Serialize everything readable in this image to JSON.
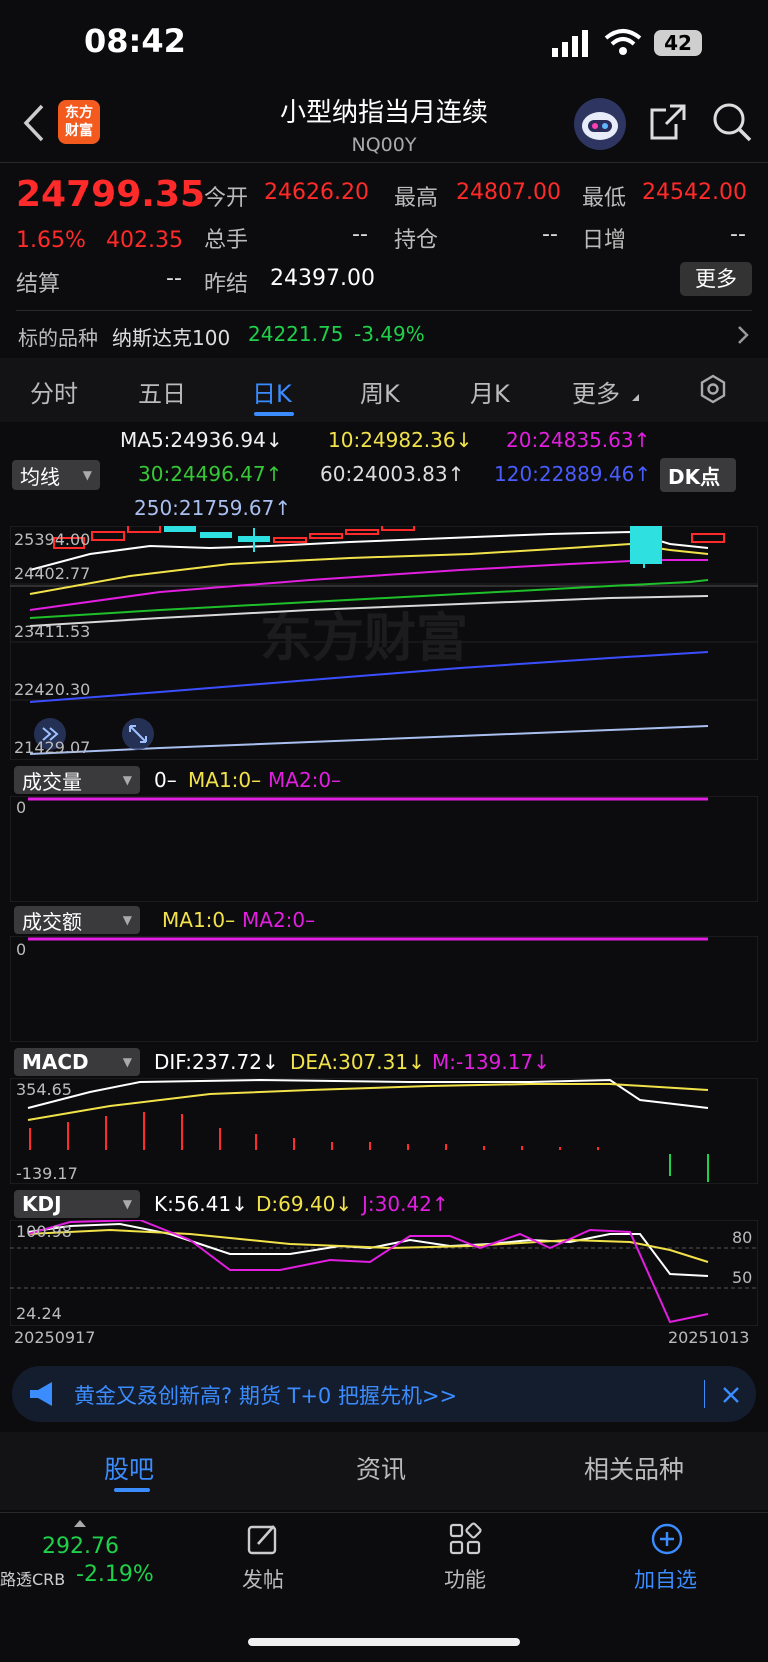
{
  "status": {
    "time": "08:42",
    "battery": "42"
  },
  "header": {
    "logo": "东方\n财富",
    "title": "小型纳指当月连续",
    "code": "NQ00Y"
  },
  "quote": {
    "price": "24799.35",
    "pct": "1.65%",
    "change": "402.35",
    "open_label": "今开",
    "open": "24626.20",
    "high_label": "最高",
    "high": "24807.00",
    "low_label": "最低",
    "low": "24542.00",
    "vol_label": "总手",
    "vol": "--",
    "oi_label": "持仓",
    "oi": "--",
    "daily_label": "日增",
    "daily": "--",
    "settle_label": "结算",
    "settle": "--",
    "prev_settle_label": "昨结",
    "prev_settle": "24397.00",
    "more": "更多"
  },
  "underlying": {
    "label": "标的品种",
    "name": "纳斯达克100",
    "value": "24221.75",
    "pct": "-3.49%"
  },
  "period_tabs": [
    "分时",
    "五日",
    "日K",
    "周K",
    "月K",
    "更多"
  ],
  "active_tab": "日K",
  "ma": {
    "selector": "均线",
    "ma5": "MA5:24936.94↓",
    "ma10": "10:24982.36↓",
    "ma20": "20:24835.63↑",
    "ma30": "30:24496.47↑",
    "ma60": "60:24003.83↑",
    "ma120": "120:22889.46↑",
    "ma250": "250:21759.67↑",
    "dk": "DK点"
  },
  "chart_data": {
    "type": "candlestick",
    "y_ticks": [
      "25394.00",
      "24402.77",
      "23411.53",
      "22420.30",
      "21429.07"
    ],
    "x_start": "20250917",
    "x_end": "20251013",
    "watermark": "东方财富",
    "colors": {
      "up": "#ff2a2a",
      "down": "#2fe0e0",
      "ma5": "#ffffff",
      "ma10": "#f2e24a",
      "ma20": "#e21ee0",
      "ma30": "#1fbf2a",
      "ma60": "#d8d8d8",
      "ma120": "#3a4fff",
      "ma250": "#a9bff0"
    }
  },
  "volume": {
    "selector": "成交量",
    "val": "0–",
    "ma1": "MA1:0–",
    "ma2": "MA2:0–",
    "zero": "0"
  },
  "amount": {
    "selector": "成交额",
    "ma1": "MA1:0–",
    "ma2": "MA2:0–",
    "zero": "0"
  },
  "macd": {
    "selector": "MACD",
    "dif": "DIF:237.72↓",
    "dea": "DEA:307.31↓",
    "m": "M:-139.17↓",
    "top": "354.65",
    "bottom": "-139.17"
  },
  "kdj": {
    "selector": "KDJ",
    "k": "K:56.41↓",
    "d": "D:69.40↓",
    "j": "J:30.42↑",
    "top": "100.98",
    "bottom": "24.24",
    "r80": "80",
    "r50": "50"
  },
  "banner": {
    "text": "黄金又叒创新高? 期货 T+0 把握先机>>"
  },
  "bottom_tabs": [
    "股吧",
    "资讯",
    "相关品种"
  ],
  "bottom_nav": {
    "crb_value": "292.76",
    "crb_label": "路透CRB",
    "crb_pct": "-2.19%",
    "post": "发帖",
    "func": "功能",
    "add": "加自选"
  }
}
